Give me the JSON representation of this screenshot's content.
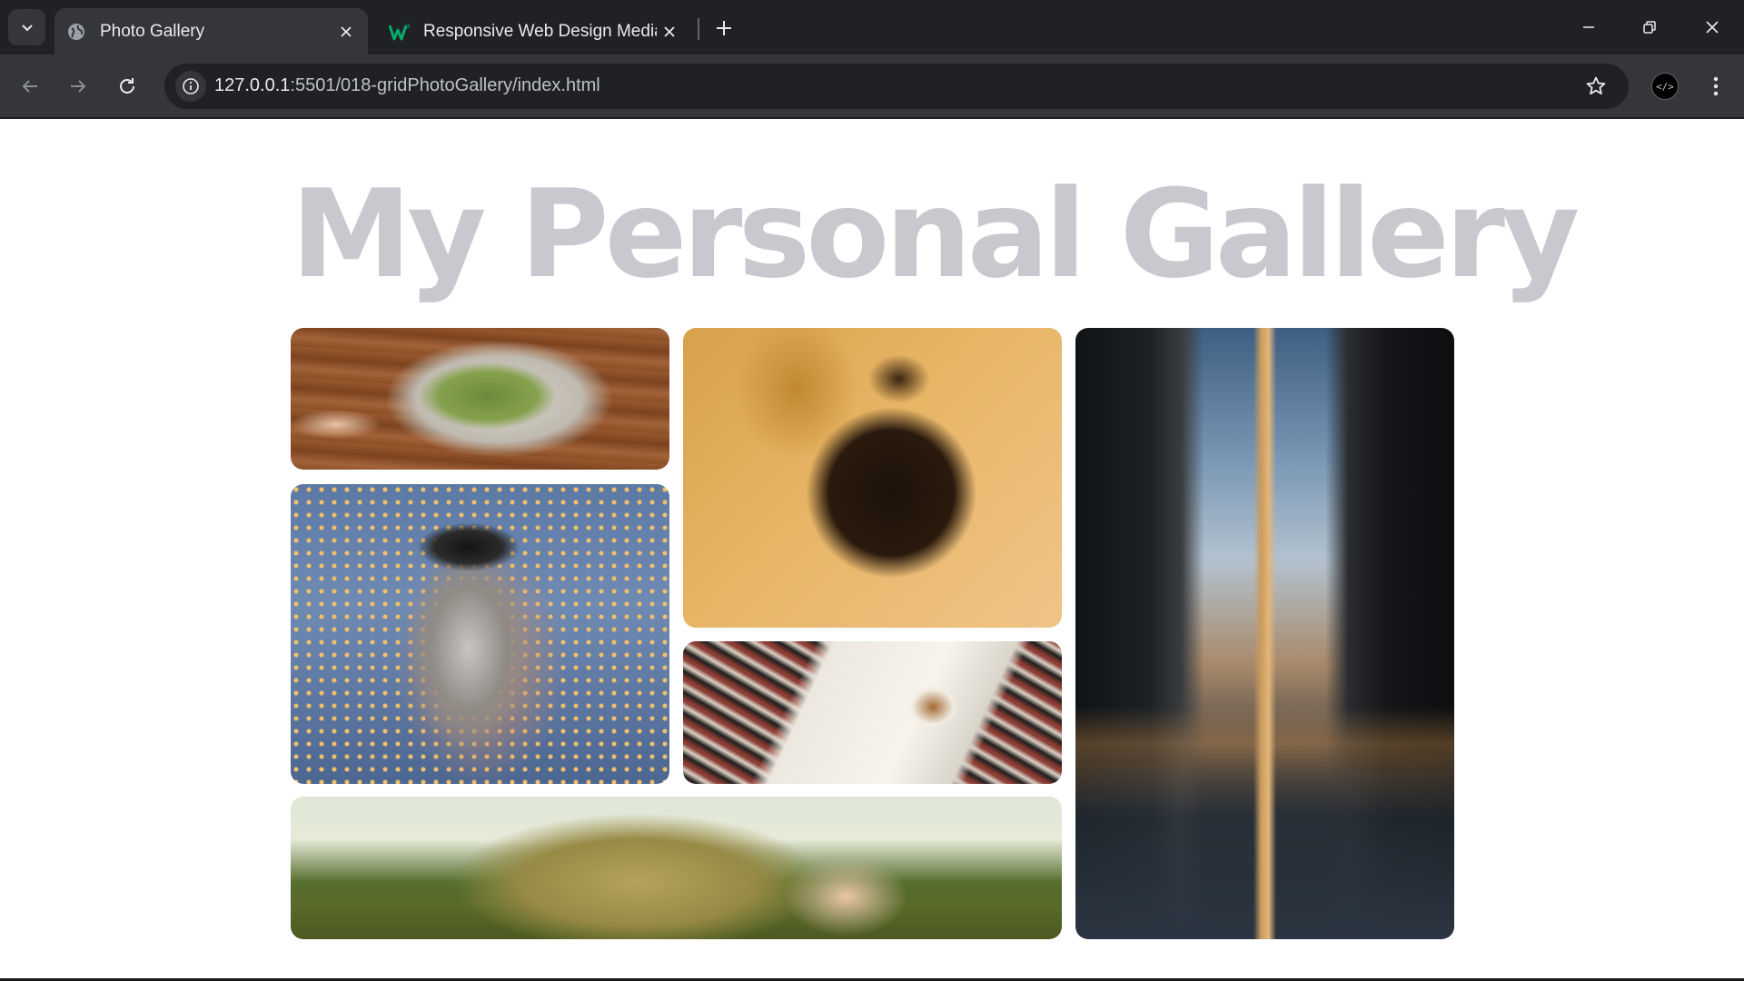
{
  "browser": {
    "tabs": [
      {
        "title": "Photo Gallery",
        "favicon": "globe-icon",
        "active": true
      },
      {
        "title": "Responsive Web Design Media",
        "favicon": "w3schools-icon",
        "active": false
      }
    ],
    "url_host": "127.0.0.1",
    "url_rest": ":5501/018-gridPhotoGallery/index.html",
    "extension_label": "</>",
    "colors": {
      "tabbar": "#202124",
      "toolbar": "#35363a",
      "omnibox": "#202124",
      "text": "#e8eaed"
    }
  },
  "page": {
    "heading": "My Personal Gallery",
    "heading_color": "#c9c8cf",
    "photos": [
      {
        "name": "salad bowl held over wooden table"
      },
      {
        "name": "person in fur coat against orange wall"
      },
      {
        "name": "city street with elevated train tracks"
      },
      {
        "name": "woman wearing goggles and silver hood"
      },
      {
        "name": "open book with coffee cup and plaid blanket"
      },
      {
        "name": "woman lying in grass field"
      }
    ]
  }
}
